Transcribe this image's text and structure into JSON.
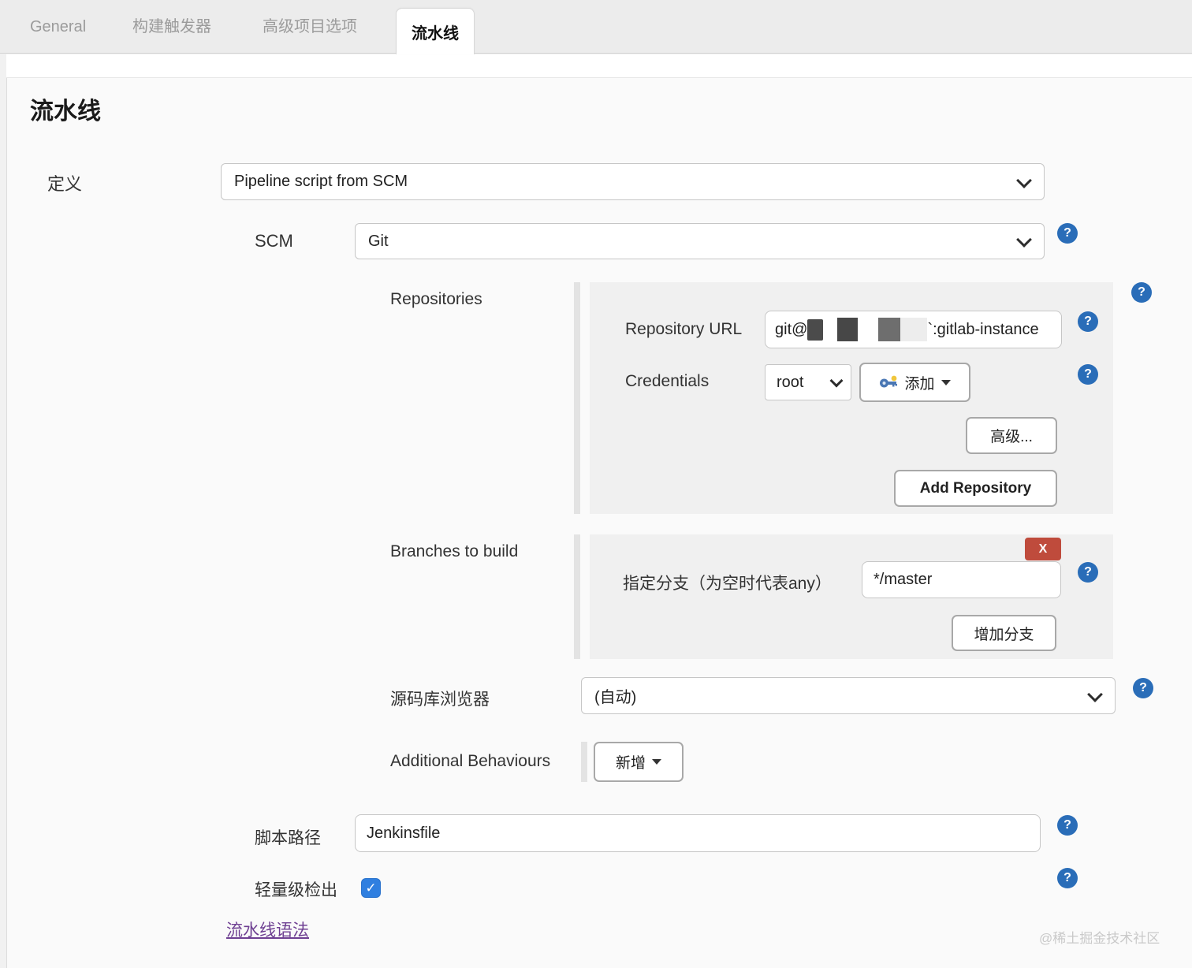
{
  "tabs": [
    {
      "label": "General",
      "active": false
    },
    {
      "label": "构建触发器",
      "active": false
    },
    {
      "label": "高级项目选项",
      "active": false
    },
    {
      "label": "流水线",
      "active": true
    }
  ],
  "page": {
    "title": "流水线",
    "watermark": "@稀土掘金技术社区"
  },
  "icons": {
    "help": "?",
    "checkmark": "✓"
  },
  "form": {
    "definition": {
      "label": "定义",
      "value": "Pipeline script from SCM"
    },
    "scm": {
      "label": "SCM",
      "value": "Git"
    },
    "repositories": {
      "label": "Repositories",
      "repository_url": {
        "label": "Repository URL",
        "value_prefix": "git@",
        "value_suffix": "`:gitlab-instance",
        "redacted": true
      },
      "credentials": {
        "label": "Credentials",
        "selected": "root",
        "add_button": "添加"
      },
      "advanced_button": "高级...",
      "add_repository_button": "Add Repository"
    },
    "branches": {
      "label": "Branches to build",
      "delete_button": "X",
      "branch_spec": {
        "label": "指定分支（为空时代表any）",
        "value": "*/master"
      },
      "add_branch_button": "增加分支"
    },
    "repo_browser": {
      "label": "源码库浏览器",
      "value": "(自动)"
    },
    "additional_behaviours": {
      "label": "Additional Behaviours",
      "add_button": "新增"
    },
    "script_path": {
      "label": "脚本路径",
      "value": "Jenkinsfile"
    },
    "lightweight_checkout": {
      "label": "轻量级检出",
      "checked": true
    },
    "pipeline_syntax_link": "流水线语法"
  },
  "colors": {
    "help_blue": "#2a6db8",
    "danger_red": "#bf4b3c",
    "checkbox_blue": "#2f7fe0",
    "link_purple": "#6e3f92",
    "panel_gray": "#f0f0f0",
    "tabbar_gray": "#ececec"
  }
}
